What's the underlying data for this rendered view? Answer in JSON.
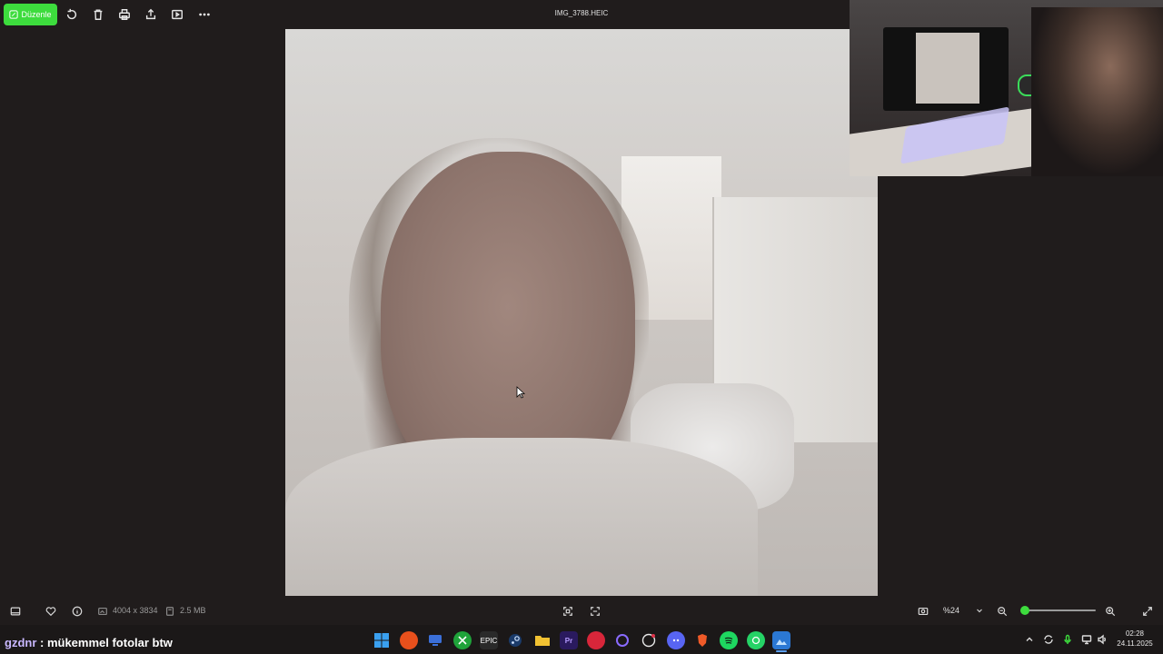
{
  "toolbar": {
    "edit_label": "Düzenle",
    "file_title": "IMG_3788.HEIC",
    "accent_color": "#3ddc3d",
    "icons": [
      "rotate-icon",
      "delete-icon",
      "print-icon",
      "share-icon",
      "slideshow-icon",
      "more-icon"
    ]
  },
  "info_bar": {
    "dimensions": "4004 x 3834",
    "file_size": "2.5 MB",
    "zoom_value": "%24",
    "zoom_level_fraction": 0.05
  },
  "chat": {
    "username": "gzdnr",
    "message": " : mükemmel fotolar btw"
  },
  "taskbar": {
    "apps": [
      "windows-start",
      "browser",
      "display",
      "xbox",
      "epic-games",
      "steam",
      "file-explorer",
      "premiere-pro",
      "red-app",
      "circle-app",
      "chatgpt",
      "discord",
      "brave",
      "spotify",
      "whatsapp",
      "photos"
    ],
    "active_app": "photos"
  },
  "tray": {
    "time": "02:28",
    "date": "24.11.2025"
  }
}
